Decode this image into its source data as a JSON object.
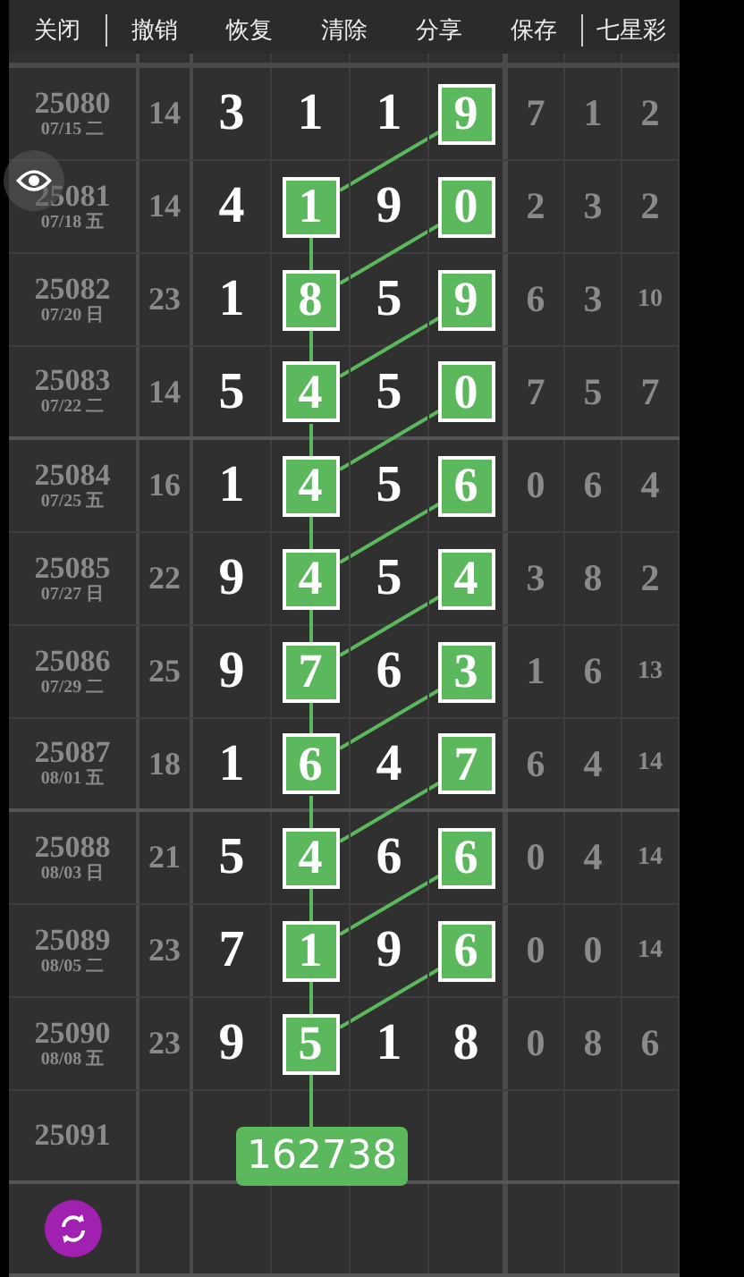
{
  "toolbar": [
    {
      "label": "关闭"
    },
    {
      "label": "撤销"
    },
    {
      "label": "恢复"
    },
    {
      "label": "清除"
    },
    {
      "label": "分享"
    },
    {
      "label": "保存"
    },
    {
      "label": "七星彩"
    }
  ],
  "rows": [
    {
      "issue": "25080",
      "date": "07/15 二",
      "sum": "14",
      "digits": [
        {
          "value": "3",
          "highlighted": false
        },
        {
          "value": "1",
          "highlighted": false
        },
        {
          "value": "1",
          "highlighted": false
        },
        {
          "value": "9",
          "highlighted": true
        }
      ],
      "extra": [
        "7",
        "1",
        "2"
      ]
    },
    {
      "issue": "25081",
      "date": "07/18 五",
      "sum": "14",
      "digits": [
        {
          "value": "4",
          "highlighted": false
        },
        {
          "value": "1",
          "highlighted": true
        },
        {
          "value": "9",
          "highlighted": false
        },
        {
          "value": "0",
          "highlighted": true
        }
      ],
      "extra": [
        "2",
        "3",
        "2"
      ]
    },
    {
      "issue": "25082",
      "date": "07/20 日",
      "sum": "23",
      "digits": [
        {
          "value": "1",
          "highlighted": false
        },
        {
          "value": "8",
          "highlighted": true
        },
        {
          "value": "5",
          "highlighted": false
        },
        {
          "value": "9",
          "highlighted": true
        }
      ],
      "extra": [
        "6",
        "3",
        "10"
      ]
    },
    {
      "issue": "25083",
      "date": "07/22 二",
      "sum": "14",
      "digits": [
        {
          "value": "5",
          "highlighted": false
        },
        {
          "value": "4",
          "highlighted": true
        },
        {
          "value": "5",
          "highlighted": false
        },
        {
          "value": "0",
          "highlighted": true
        }
      ],
      "extra": [
        "7",
        "5",
        "7"
      ]
    },
    {
      "issue": "25084",
      "date": "07/25 五",
      "sum": "16",
      "digits": [
        {
          "value": "1",
          "highlighted": false
        },
        {
          "value": "4",
          "highlighted": true
        },
        {
          "value": "5",
          "highlighted": false
        },
        {
          "value": "6",
          "highlighted": true
        }
      ],
      "extra": [
        "0",
        "6",
        "4"
      ]
    },
    {
      "issue": "25085",
      "date": "07/27 日",
      "sum": "22",
      "digits": [
        {
          "value": "9",
          "highlighted": false
        },
        {
          "value": "4",
          "highlighted": true
        },
        {
          "value": "5",
          "highlighted": false
        },
        {
          "value": "4",
          "highlighted": true
        }
      ],
      "extra": [
        "3",
        "8",
        "2"
      ]
    },
    {
      "issue": "25086",
      "date": "07/29 二",
      "sum": "25",
      "digits": [
        {
          "value": "9",
          "highlighted": false
        },
        {
          "value": "7",
          "highlighted": true
        },
        {
          "value": "6",
          "highlighted": false
        },
        {
          "value": "3",
          "highlighted": true
        }
      ],
      "extra": [
        "1",
        "6",
        "13"
      ]
    },
    {
      "issue": "25087",
      "date": "08/01 五",
      "sum": "18",
      "digits": [
        {
          "value": "1",
          "highlighted": false
        },
        {
          "value": "6",
          "highlighted": true
        },
        {
          "value": "4",
          "highlighted": false
        },
        {
          "value": "7",
          "highlighted": true
        }
      ],
      "extra": [
        "6",
        "4",
        "14"
      ]
    },
    {
      "issue": "25088",
      "date": "08/03 日",
      "sum": "21",
      "digits": [
        {
          "value": "5",
          "highlighted": false
        },
        {
          "value": "4",
          "highlighted": true
        },
        {
          "value": "6",
          "highlighted": false
        },
        {
          "value": "6",
          "highlighted": true
        }
      ],
      "extra": [
        "0",
        "4",
        "14"
      ]
    },
    {
      "issue": "25089",
      "date": "08/05 二",
      "sum": "23",
      "digits": [
        {
          "value": "7",
          "highlighted": false
        },
        {
          "value": "1",
          "highlighted": true
        },
        {
          "value": "9",
          "highlighted": false
        },
        {
          "value": "6",
          "highlighted": true
        }
      ],
      "extra": [
        "0",
        "0",
        "14"
      ]
    },
    {
      "issue": "25090",
      "date": "08/08 五",
      "sum": "23",
      "digits": [
        {
          "value": "9",
          "highlighted": false
        },
        {
          "value": "5",
          "highlighted": true
        },
        {
          "value": "1",
          "highlighted": false
        },
        {
          "value": "8",
          "highlighted": false
        }
      ],
      "extra": [
        "0",
        "8",
        "6"
      ]
    },
    {
      "issue": "25091"
    }
  ],
  "prediction": "162738"
}
